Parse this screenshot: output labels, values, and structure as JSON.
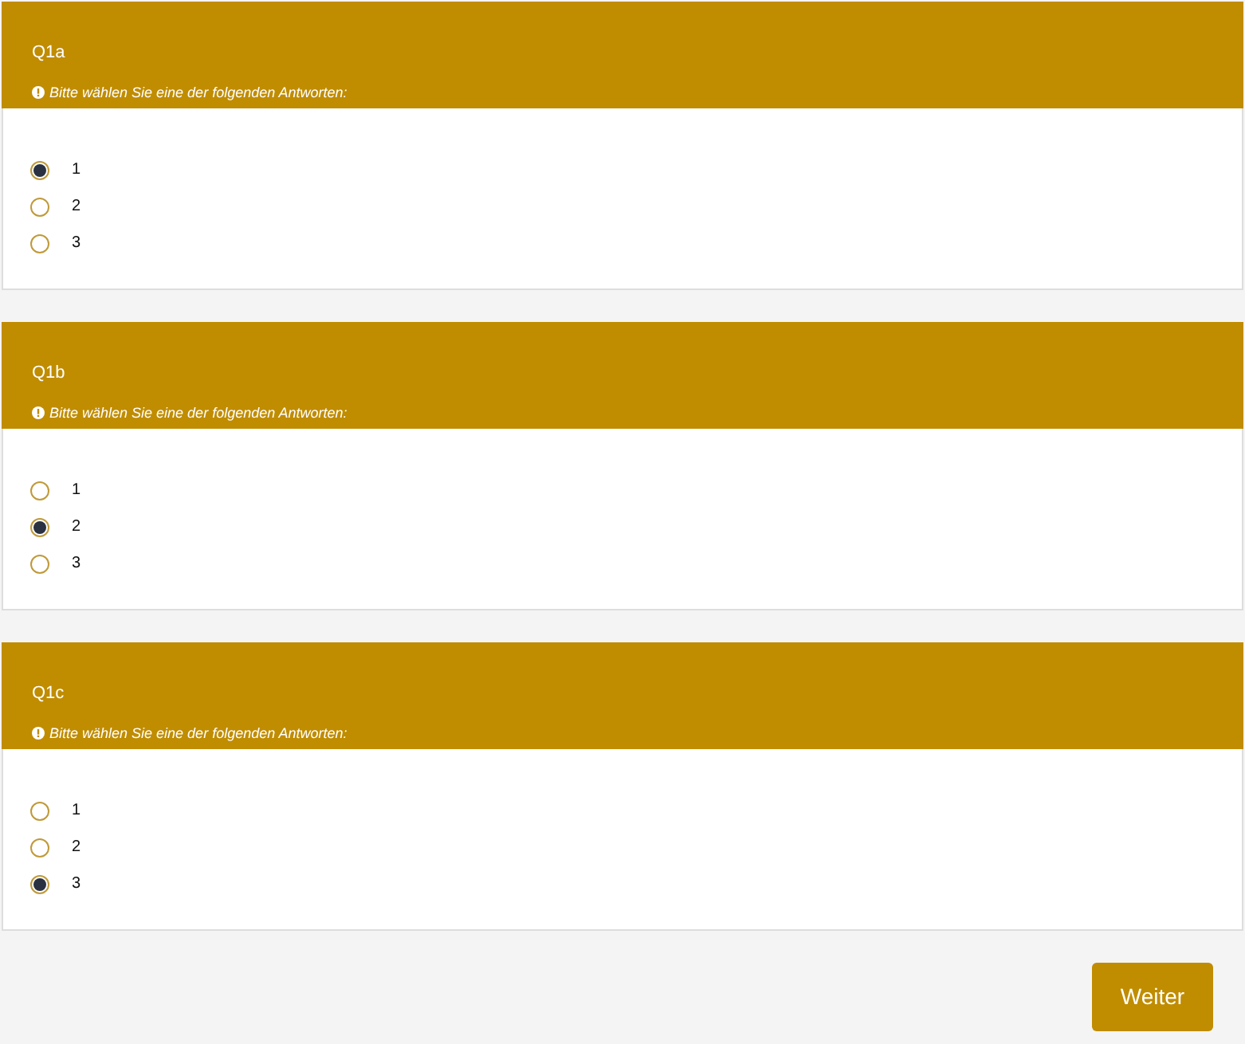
{
  "questions": [
    {
      "title": "Q1a",
      "hint": "Bitte wählen Sie eine der folgenden Antworten:",
      "options": [
        {
          "label": "1",
          "selected": true
        },
        {
          "label": "2",
          "selected": false
        },
        {
          "label": "3",
          "selected": false
        }
      ]
    },
    {
      "title": "Q1b",
      "hint": "Bitte wählen Sie eine der folgenden Antworten:",
      "options": [
        {
          "label": "1",
          "selected": false
        },
        {
          "label": "2",
          "selected": true
        },
        {
          "label": "3",
          "selected": false
        }
      ]
    },
    {
      "title": "Q1c",
      "hint": "Bitte wählen Sie eine der folgenden Antworten:",
      "options": [
        {
          "label": "1",
          "selected": false
        },
        {
          "label": "2",
          "selected": false
        },
        {
          "label": "3",
          "selected": true
        }
      ]
    }
  ],
  "next_button": "Weiter"
}
